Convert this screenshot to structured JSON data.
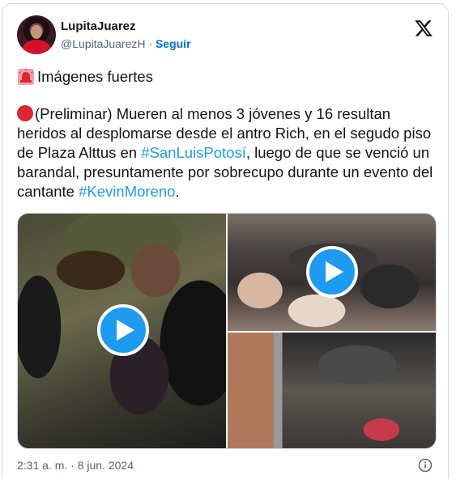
{
  "tweet": {
    "display_name": "LupitaJuarez",
    "handle": "@LupitaJuarezH",
    "separator": " · ",
    "follow_label": "Seguir",
    "line1": "Imágenes fuertes",
    "para_part1": "(Preliminar) Mueren al menos 3 jóvenes y 16 resultan heridos al desplomarse desde el antro Rich, en el segudo piso de Plaza Alttus en ",
    "hashtag1": "#SanLuisPotosí",
    "para_part2": ", luego de que se venció un barandal, presuntamente por sobrecupo durante un evento del cantante ",
    "hashtag2": "#KevinMoreno",
    "para_part3": ".",
    "timestamp": "2:31 a. m. · 8 jun. 2024"
  },
  "icons": {
    "siren": "siren-emoji-icon",
    "red_circle": "red-circle-emoji-icon",
    "brand": "x-logo-icon",
    "info": "info-icon",
    "play": "play-icon"
  },
  "colors": {
    "link": "#1d9bf0",
    "follow": "#006fd6",
    "muted": "#536471",
    "text": "#0f1419"
  }
}
